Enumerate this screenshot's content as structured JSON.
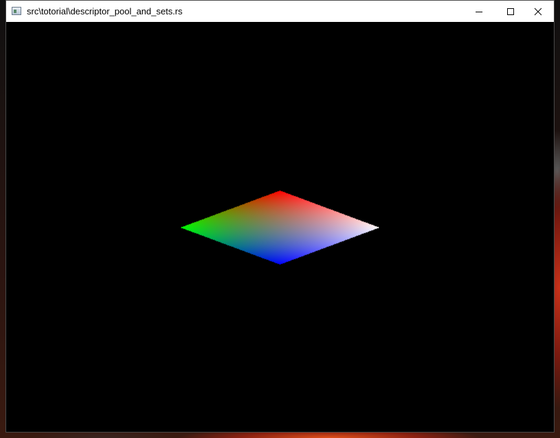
{
  "window": {
    "title": "src\\totorial\\descriptor_pool_and_sets.rs",
    "controls": {
      "minimize_icon": "minimize-icon",
      "maximize_icon": "maximize-icon",
      "close_icon": "close-icon"
    }
  },
  "scene": {
    "background_color": "#000000",
    "quad_vertex_colors": {
      "top": "#ff0000",
      "right": "#ffffff",
      "bottom": "#0000ff",
      "left": "#00ff00"
    }
  }
}
